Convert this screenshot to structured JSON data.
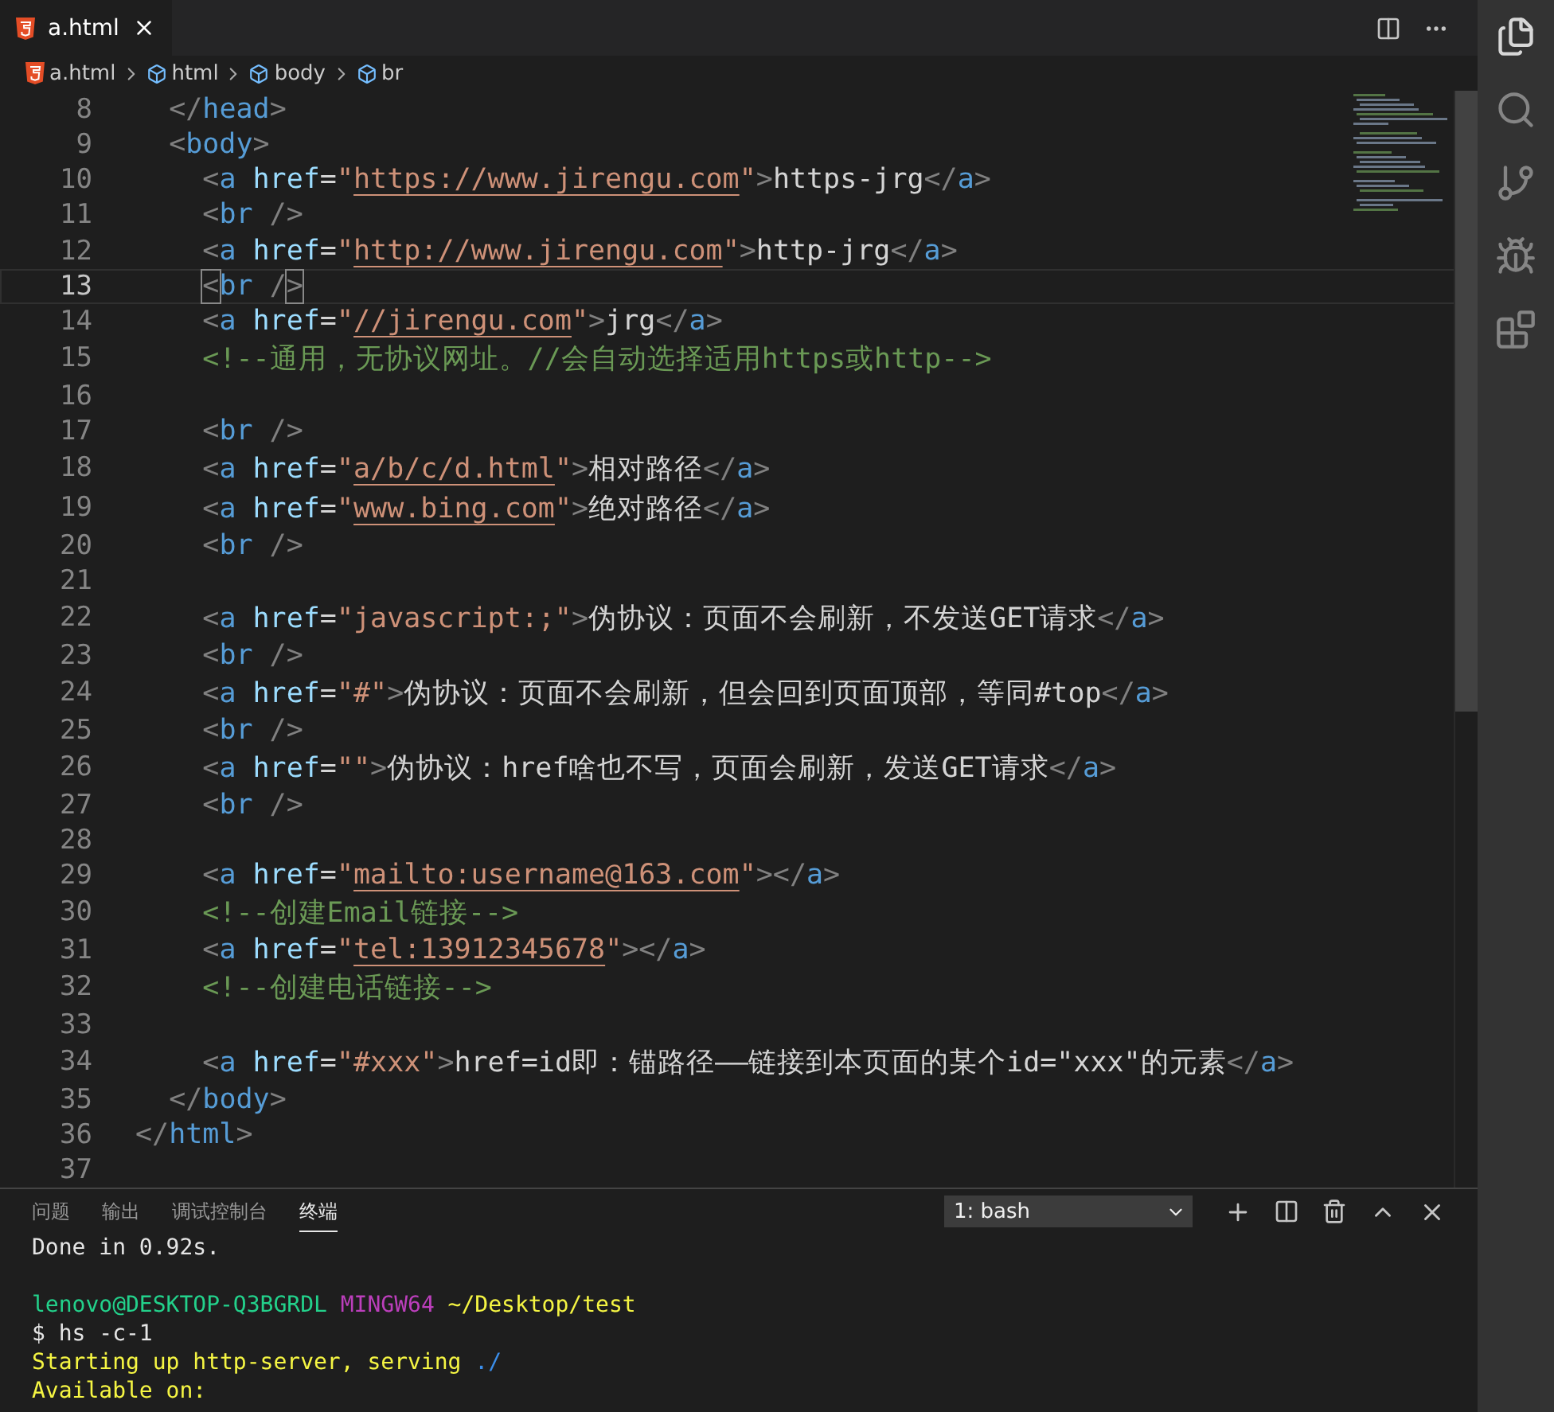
{
  "tabs": [
    {
      "label": "a.html",
      "selected": true
    }
  ],
  "breadcrumb": [
    {
      "label": "a.html",
      "kind": "file"
    },
    {
      "label": "html",
      "kind": "element"
    },
    {
      "label": "body",
      "kind": "element"
    },
    {
      "label": "br",
      "kind": "element"
    }
  ],
  "editor": {
    "lines": [
      {
        "number": "8",
        "current": false,
        "tokens": [
          {
            "kind": "punct",
            "text": "  </"
          },
          {
            "kind": "tag",
            "text": "head"
          },
          {
            "kind": "punct",
            "text": ">"
          }
        ]
      },
      {
        "number": "9",
        "current": false,
        "tokens": [
          {
            "kind": "punct",
            "text": "  <"
          },
          {
            "kind": "tag",
            "text": "body"
          },
          {
            "kind": "punct",
            "text": ">"
          }
        ]
      },
      {
        "number": "10",
        "current": false,
        "tokens": [
          {
            "kind": "punct",
            "text": "    <"
          },
          {
            "kind": "tag",
            "text": "a"
          },
          {
            "kind": "attr",
            "text": " href"
          },
          {
            "kind": "text",
            "text": "="
          },
          {
            "kind": "string",
            "text": "\""
          },
          {
            "kind": "link",
            "text": "https://www.jirengu.com"
          },
          {
            "kind": "string",
            "text": "\""
          },
          {
            "kind": "punct",
            "text": ">"
          },
          {
            "kind": "text",
            "text": "https-jrg"
          },
          {
            "kind": "punct",
            "text": "</"
          },
          {
            "kind": "tag",
            "text": "a"
          },
          {
            "kind": "punct",
            "text": ">"
          }
        ]
      },
      {
        "number": "11",
        "current": false,
        "tokens": [
          {
            "kind": "punct",
            "text": "    <"
          },
          {
            "kind": "tag",
            "text": "br"
          },
          {
            "kind": "punct",
            "text": " />"
          }
        ]
      },
      {
        "number": "12",
        "current": false,
        "tokens": [
          {
            "kind": "punct",
            "text": "    <"
          },
          {
            "kind": "tag",
            "text": "a"
          },
          {
            "kind": "attr",
            "text": " href"
          },
          {
            "kind": "text",
            "text": "="
          },
          {
            "kind": "string",
            "text": "\""
          },
          {
            "kind": "link",
            "text": "http://www.jirengu.com"
          },
          {
            "kind": "string",
            "text": "\""
          },
          {
            "kind": "punct",
            "text": ">"
          },
          {
            "kind": "text",
            "text": "http-jrg"
          },
          {
            "kind": "punct",
            "text": "</"
          },
          {
            "kind": "tag",
            "text": "a"
          },
          {
            "kind": "punct",
            "text": ">"
          }
        ]
      },
      {
        "number": "13",
        "current": true,
        "tokens": [
          {
            "kind": "match",
            "text": "    <"
          },
          {
            "kind": "tag",
            "text": "br"
          },
          {
            "kind": "punct",
            "text": " /"
          },
          {
            "kind": "match",
            "text": ">"
          }
        ]
      },
      {
        "number": "14",
        "current": false,
        "tokens": [
          {
            "kind": "punct",
            "text": "    <"
          },
          {
            "kind": "tag",
            "text": "a"
          },
          {
            "kind": "attr",
            "text": " href"
          },
          {
            "kind": "text",
            "text": "="
          },
          {
            "kind": "string",
            "text": "\""
          },
          {
            "kind": "link",
            "text": "//jirengu.com"
          },
          {
            "kind": "string",
            "text": "\""
          },
          {
            "kind": "punct",
            "text": ">"
          },
          {
            "kind": "text",
            "text": "jrg"
          },
          {
            "kind": "punct",
            "text": "</"
          },
          {
            "kind": "tag",
            "text": "a"
          },
          {
            "kind": "punct",
            "text": ">"
          }
        ]
      },
      {
        "number": "15",
        "current": false,
        "tokens": [
          {
            "kind": "comment",
            "text": "    <!--通用，无协议网址。//会自动选择适用https或http-->"
          }
        ]
      },
      {
        "number": "16",
        "current": false
      },
      {
        "number": "17",
        "current": false,
        "tokens": [
          {
            "kind": "punct",
            "text": "    <"
          },
          {
            "kind": "tag",
            "text": "br"
          },
          {
            "kind": "punct",
            "text": " />"
          }
        ]
      },
      {
        "number": "18",
        "current": false,
        "tokens": [
          {
            "kind": "punct",
            "text": "    <"
          },
          {
            "kind": "tag",
            "text": "a"
          },
          {
            "kind": "attr",
            "text": " href"
          },
          {
            "kind": "text",
            "text": "="
          },
          {
            "kind": "string",
            "text": "\""
          },
          {
            "kind": "link",
            "text": "a/b/c/d.html"
          },
          {
            "kind": "string",
            "text": "\""
          },
          {
            "kind": "punct",
            "text": ">"
          },
          {
            "kind": "text",
            "text": "相对路径"
          },
          {
            "kind": "punct",
            "text": "</"
          },
          {
            "kind": "tag",
            "text": "a"
          },
          {
            "kind": "punct",
            "text": ">"
          }
        ]
      },
      {
        "number": "19",
        "current": false,
        "tokens": [
          {
            "kind": "punct",
            "text": "    <"
          },
          {
            "kind": "tag",
            "text": "a"
          },
          {
            "kind": "attr",
            "text": " href"
          },
          {
            "kind": "text",
            "text": "="
          },
          {
            "kind": "string",
            "text": "\""
          },
          {
            "kind": "link",
            "text": "www.bing.com"
          },
          {
            "kind": "string",
            "text": "\""
          },
          {
            "kind": "punct",
            "text": ">"
          },
          {
            "kind": "text",
            "text": "绝对路径"
          },
          {
            "kind": "punct",
            "text": "</"
          },
          {
            "kind": "tag",
            "text": "a"
          },
          {
            "kind": "punct",
            "text": ">"
          }
        ]
      },
      {
        "number": "20",
        "current": false,
        "tokens": [
          {
            "kind": "punct",
            "text": "    <"
          },
          {
            "kind": "tag",
            "text": "br"
          },
          {
            "kind": "punct",
            "text": " />"
          }
        ]
      },
      {
        "number": "21",
        "current": false
      },
      {
        "number": "22",
        "current": false,
        "tokens": [
          {
            "kind": "punct",
            "text": "    <"
          },
          {
            "kind": "tag",
            "text": "a"
          },
          {
            "kind": "attr",
            "text": " href"
          },
          {
            "kind": "text",
            "text": "="
          },
          {
            "kind": "string",
            "text": "\"javascript:;\""
          },
          {
            "kind": "punct",
            "text": ">"
          },
          {
            "kind": "text",
            "text": "伪协议：页面不会刷新，不发送GET请求"
          },
          {
            "kind": "punct",
            "text": "</"
          },
          {
            "kind": "tag",
            "text": "a"
          },
          {
            "kind": "punct",
            "text": ">"
          }
        ]
      },
      {
        "number": "23",
        "current": false,
        "tokens": [
          {
            "kind": "punct",
            "text": "    <"
          },
          {
            "kind": "tag",
            "text": "br"
          },
          {
            "kind": "punct",
            "text": " />"
          }
        ]
      },
      {
        "number": "24",
        "current": false,
        "tokens": [
          {
            "kind": "punct",
            "text": "    <"
          },
          {
            "kind": "tag",
            "text": "a"
          },
          {
            "kind": "attr",
            "text": " href"
          },
          {
            "kind": "text",
            "text": "="
          },
          {
            "kind": "string",
            "text": "\"#\""
          },
          {
            "kind": "punct",
            "text": ">"
          },
          {
            "kind": "text",
            "text": "伪协议：页面不会刷新，但会回到页面顶部，等同#top"
          },
          {
            "kind": "punct",
            "text": "</"
          },
          {
            "kind": "tag",
            "text": "a"
          },
          {
            "kind": "punct",
            "text": ">"
          }
        ]
      },
      {
        "number": "25",
        "current": false,
        "tokens": [
          {
            "kind": "punct",
            "text": "    <"
          },
          {
            "kind": "tag",
            "text": "br"
          },
          {
            "kind": "punct",
            "text": " />"
          }
        ]
      },
      {
        "number": "26",
        "current": false,
        "tokens": [
          {
            "kind": "punct",
            "text": "    <"
          },
          {
            "kind": "tag",
            "text": "a"
          },
          {
            "kind": "attr",
            "text": " href"
          },
          {
            "kind": "text",
            "text": "="
          },
          {
            "kind": "string",
            "text": "\"\""
          },
          {
            "kind": "punct",
            "text": ">"
          },
          {
            "kind": "text",
            "text": "伪协议：href啥也不写，页面会刷新，发送GET请求"
          },
          {
            "kind": "punct",
            "text": "</"
          },
          {
            "kind": "tag",
            "text": "a"
          },
          {
            "kind": "punct",
            "text": ">"
          }
        ]
      },
      {
        "number": "27",
        "current": false,
        "tokens": [
          {
            "kind": "punct",
            "text": "    <"
          },
          {
            "kind": "tag",
            "text": "br"
          },
          {
            "kind": "punct",
            "text": " />"
          }
        ]
      },
      {
        "number": "28",
        "current": false
      },
      {
        "number": "29",
        "current": false,
        "tokens": [
          {
            "kind": "punct",
            "text": "    <"
          },
          {
            "kind": "tag",
            "text": "a"
          },
          {
            "kind": "attr",
            "text": " href"
          },
          {
            "kind": "text",
            "text": "="
          },
          {
            "kind": "string",
            "text": "\""
          },
          {
            "kind": "link",
            "text": "mailto:username@163.com"
          },
          {
            "kind": "string",
            "text": "\""
          },
          {
            "kind": "punct",
            "text": "></"
          },
          {
            "kind": "tag",
            "text": "a"
          },
          {
            "kind": "punct",
            "text": ">"
          }
        ]
      },
      {
        "number": "30",
        "current": false,
        "tokens": [
          {
            "kind": "comment",
            "text": "    <!--创建Email链接-->"
          }
        ]
      },
      {
        "number": "31",
        "current": false,
        "tokens": [
          {
            "kind": "punct",
            "text": "    <"
          },
          {
            "kind": "tag",
            "text": "a"
          },
          {
            "kind": "attr",
            "text": " href"
          },
          {
            "kind": "text",
            "text": "="
          },
          {
            "kind": "string",
            "text": "\""
          },
          {
            "kind": "link",
            "text": "tel:13912345678"
          },
          {
            "kind": "string",
            "text": "\""
          },
          {
            "kind": "punct",
            "text": "></"
          },
          {
            "kind": "tag",
            "text": "a"
          },
          {
            "kind": "punct",
            "text": ">"
          }
        ]
      },
      {
        "number": "32",
        "current": false,
        "tokens": [
          {
            "kind": "comment",
            "text": "    <!--创建电话链接-->"
          }
        ]
      },
      {
        "number": "33",
        "current": false
      },
      {
        "number": "34",
        "current": false,
        "tokens": [
          {
            "kind": "punct",
            "text": "    <"
          },
          {
            "kind": "tag",
            "text": "a"
          },
          {
            "kind": "attr",
            "text": " href"
          },
          {
            "kind": "text",
            "text": "="
          },
          {
            "kind": "string",
            "text": "\"#xxx\""
          },
          {
            "kind": "punct",
            "text": ">"
          },
          {
            "kind": "text",
            "text": "href=id即：锚路径——链接到本页面的某个id=\"xxx\"的元素"
          },
          {
            "kind": "punct",
            "text": "</"
          },
          {
            "kind": "tag",
            "text": "a"
          },
          {
            "kind": "punct",
            "text": ">"
          }
        ]
      },
      {
        "number": "35",
        "current": false,
        "tokens": [
          {
            "kind": "punct",
            "text": "  </"
          },
          {
            "kind": "tag",
            "text": "body"
          },
          {
            "kind": "punct",
            "text": ">"
          }
        ]
      },
      {
        "number": "36",
        "current": false,
        "tokens": [
          {
            "kind": "punct",
            "text": "</"
          },
          {
            "kind": "tag",
            "text": "html"
          },
          {
            "kind": "punct",
            "text": ">"
          }
        ]
      },
      {
        "number": "37",
        "current": false
      }
    ]
  },
  "panel": {
    "tabs": [
      {
        "label": "问题",
        "selected": false
      },
      {
        "label": "输出",
        "selected": false
      },
      {
        "label": "调试控制台",
        "selected": false
      },
      {
        "label": "终端",
        "selected": true
      }
    ],
    "terminal_select": "1: bash",
    "lines": [
      {
        "segments": [
          {
            "kind": "text",
            "text": "Done in 0.92s."
          }
        ]
      },
      {
        "kind": "blank"
      },
      {
        "segments": [
          {
            "kind": "user",
            "text": "lenovo@DESKTOP-Q3BGRDL"
          },
          {
            "kind": "host",
            "text": " MINGW64"
          },
          {
            "kind": "path",
            "text": " ~/Desktop/test"
          }
        ]
      },
      {
        "segments": [
          {
            "kind": "text",
            "text": "$ hs -c-1"
          }
        ]
      },
      {
        "segments": [
          {
            "kind": "path",
            "text": "Starting up http-server, serving "
          },
          {
            "kind": "accent",
            "text": "./"
          }
        ]
      },
      {
        "segments": [
          {
            "kind": "path",
            "text": "Available on:"
          }
        ]
      }
    ]
  }
}
